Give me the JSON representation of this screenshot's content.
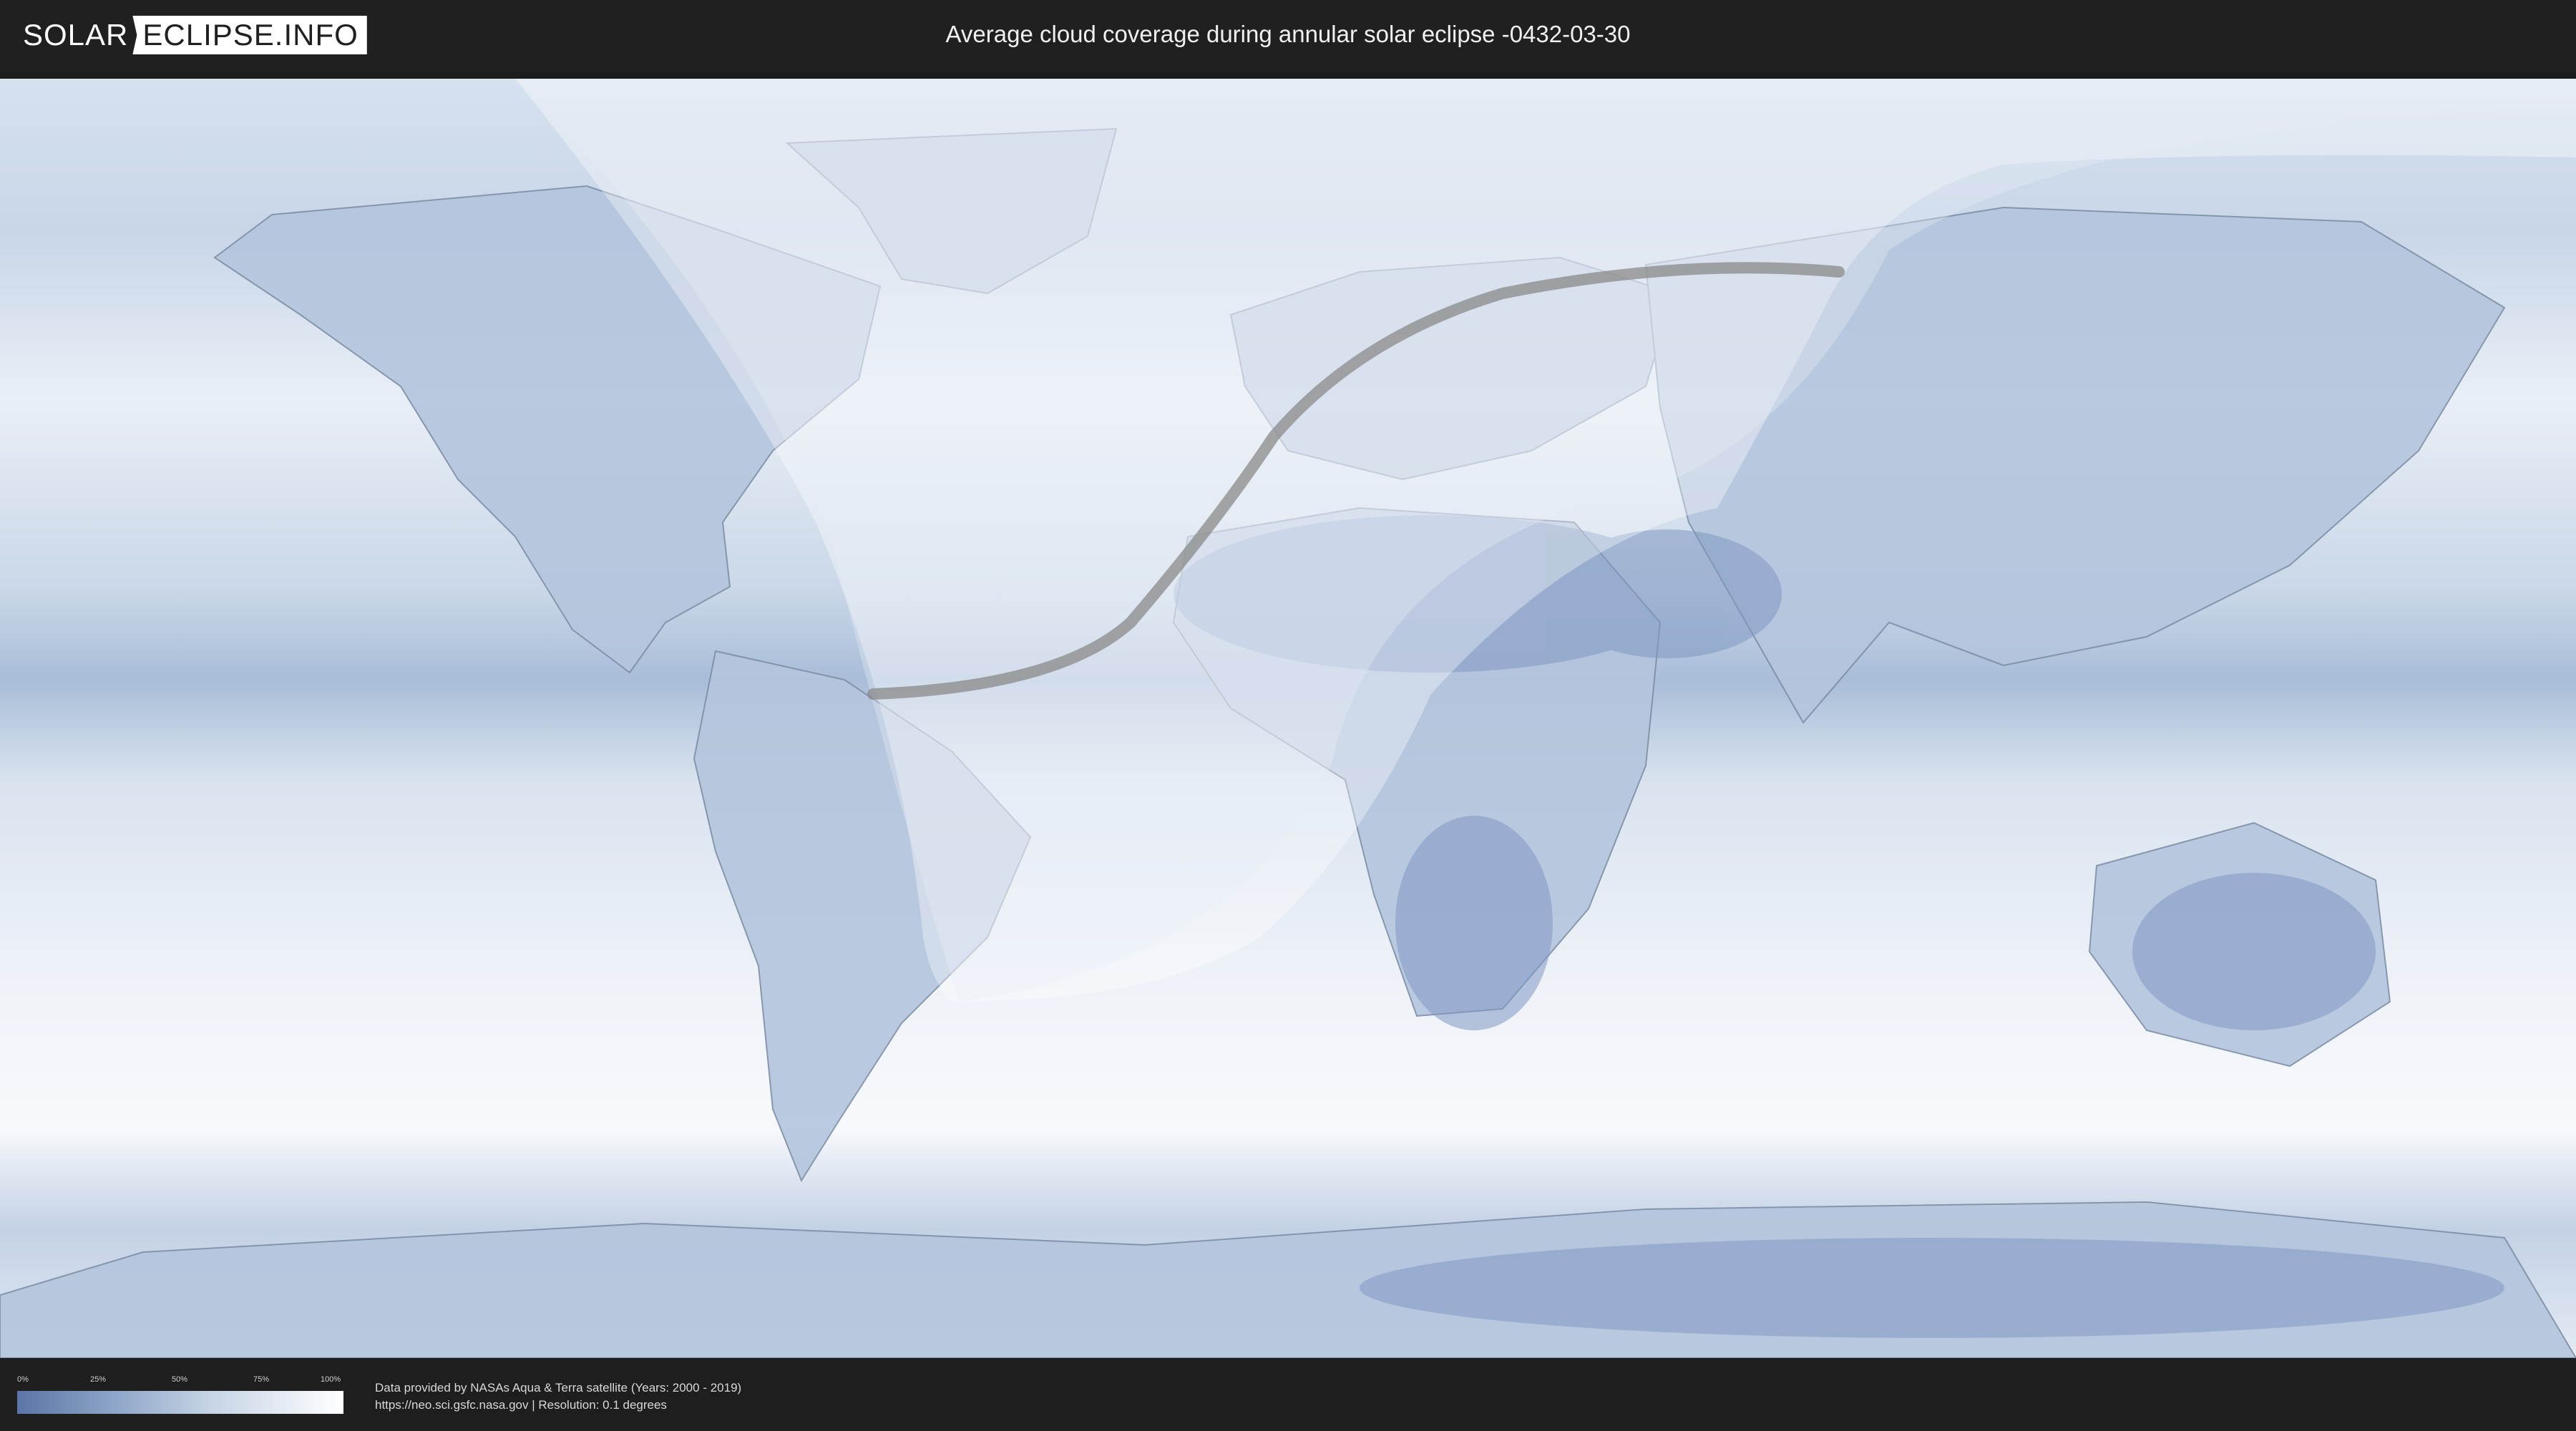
{
  "header": {
    "logo_part1": "SOLAR",
    "logo_part2": "ECLIPSE.INFO",
    "title": "Average cloud coverage during annular solar eclipse -0432-03-30"
  },
  "map": {
    "layers": [
      "cloud-coverage",
      "country-borders",
      "eclipse-visibility-zone",
      "annular-path"
    ],
    "colors": {
      "clear_sky": "#5b76a6",
      "full_cloud": "#ffffff",
      "eclipse_path": "#8a8a8a"
    }
  },
  "legend": {
    "ticks": [
      "0%",
      "25%",
      "50%",
      "75%",
      "100%"
    ]
  },
  "credits": {
    "line1": "Data provided by NASAs Aqua & Terra satellite (Years: 2000 - 2019)",
    "line2": "https://neo.sci.gsfc.nasa.gov | Resolution: 0.1 degrees"
  }
}
